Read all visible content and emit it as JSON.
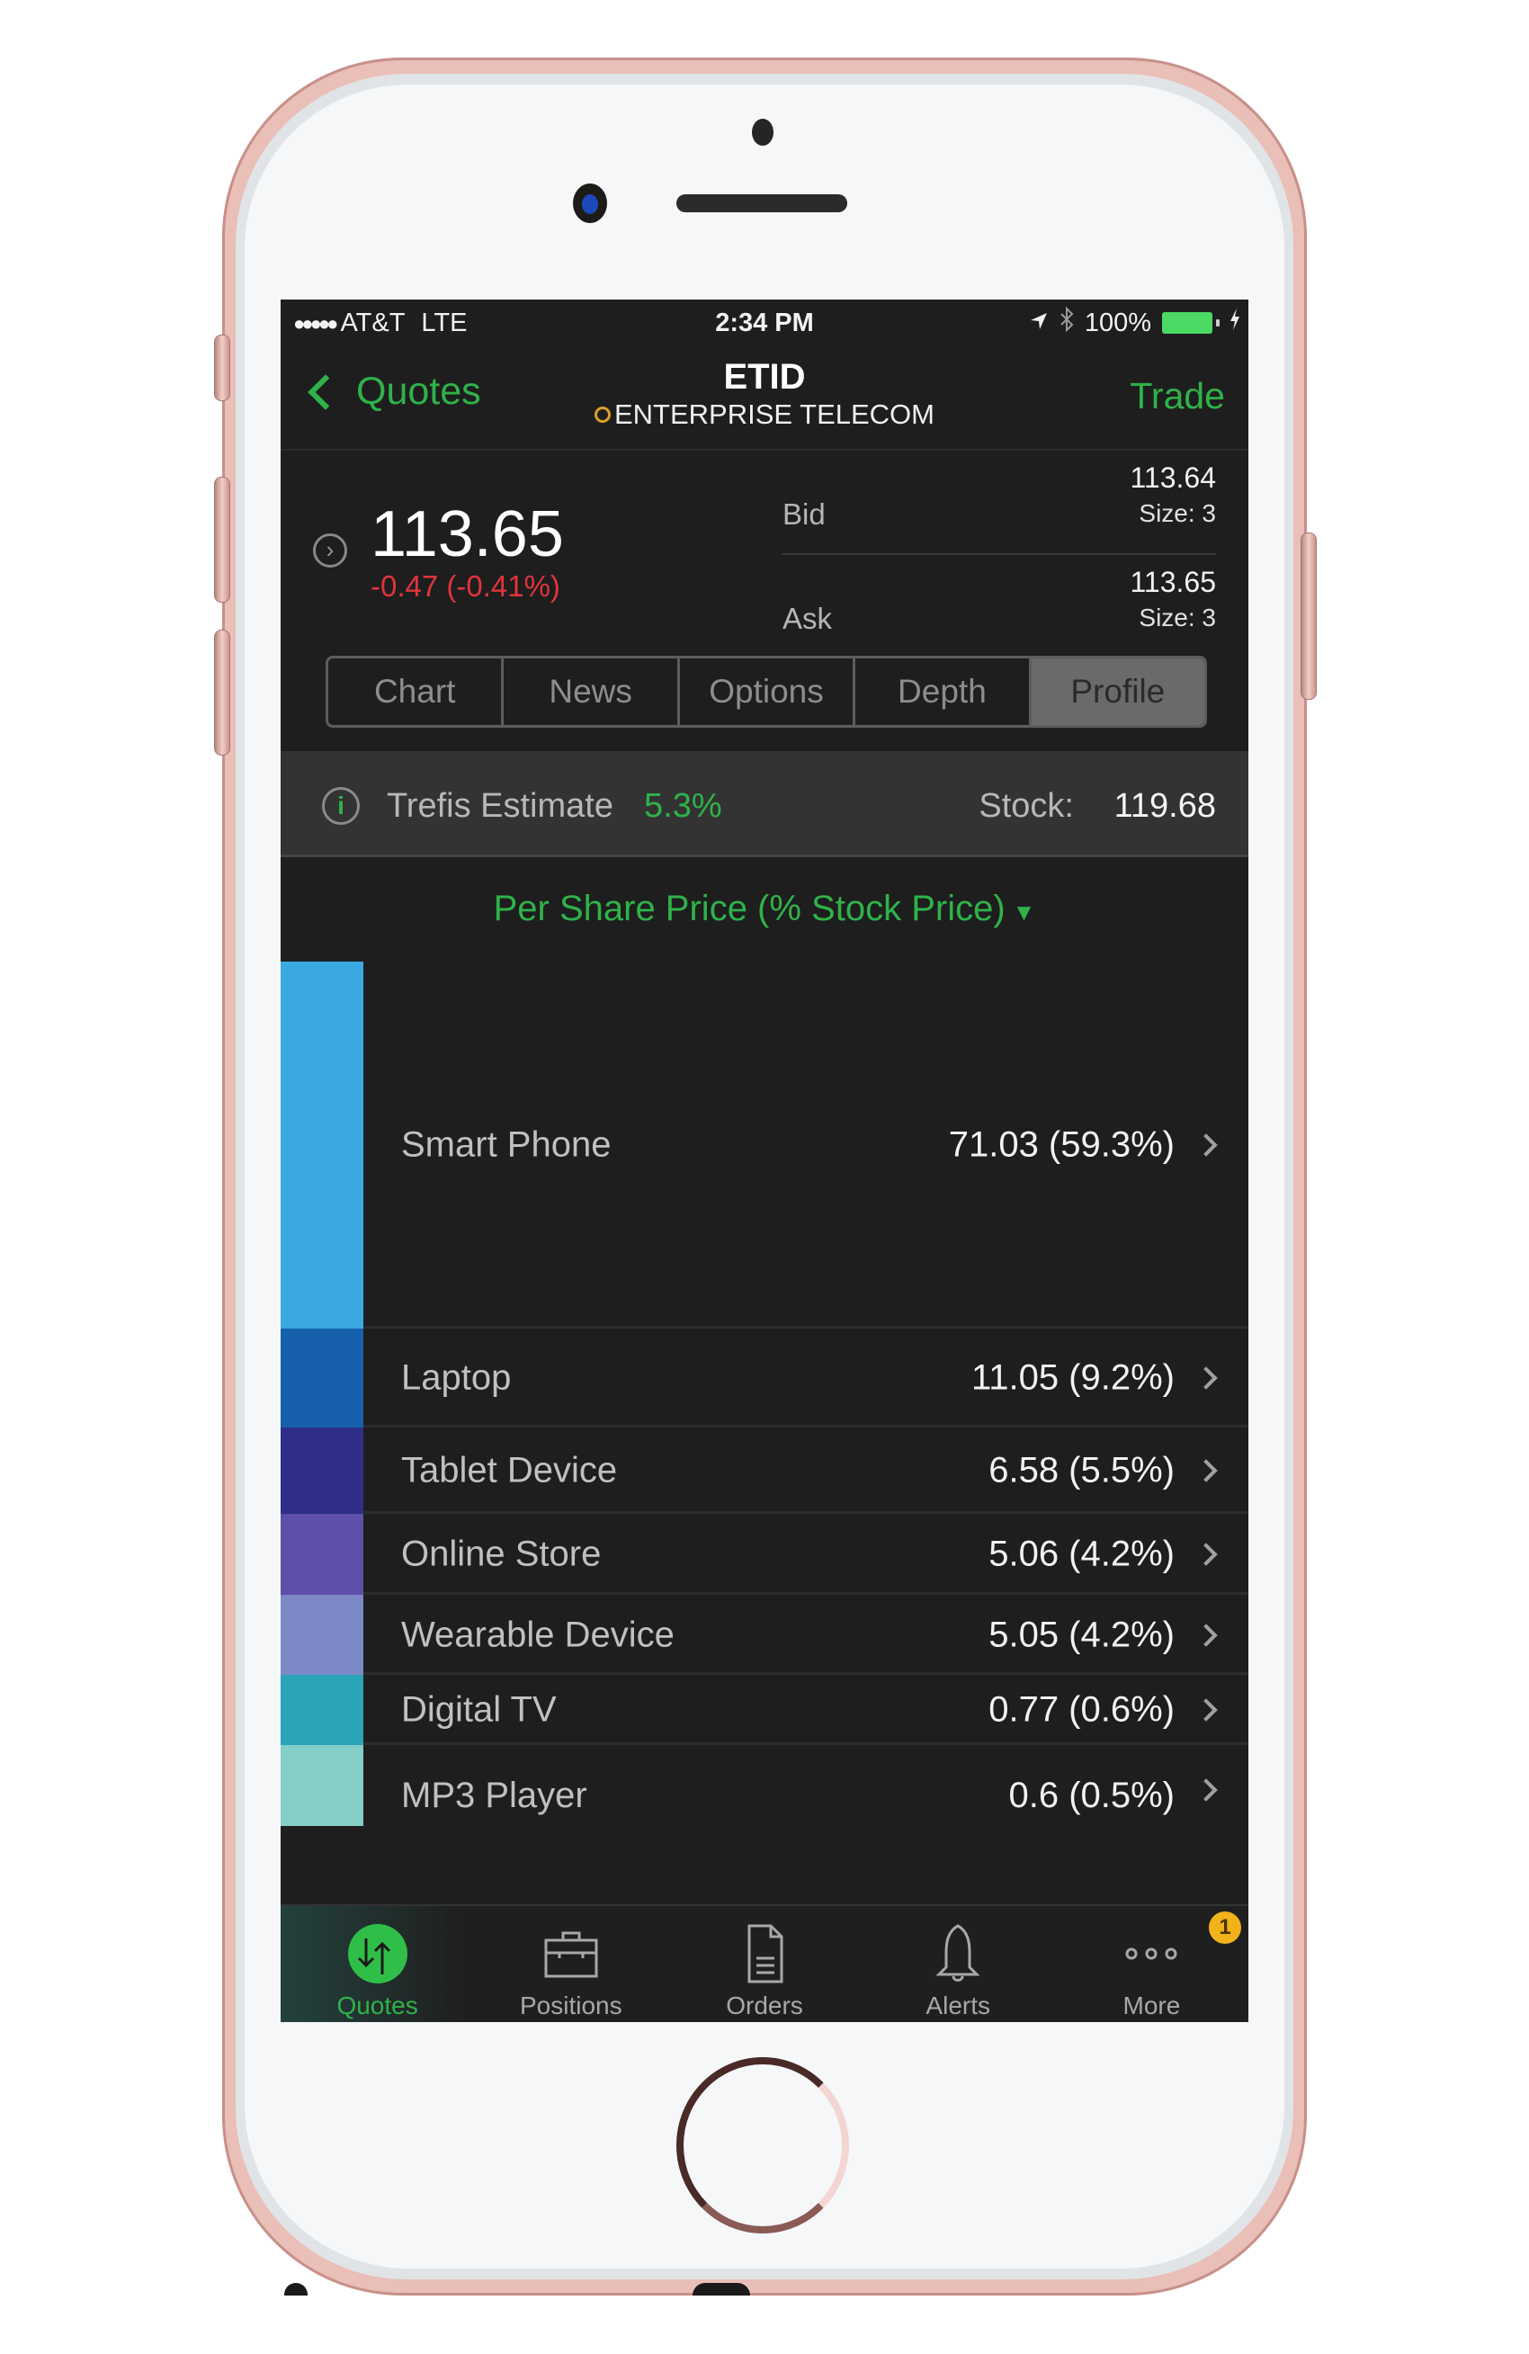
{
  "status_bar": {
    "signal": "●●●●●",
    "carrier": "AT&T",
    "network": "LTE",
    "time": "2:34 PM",
    "battery": "100%",
    "icons": [
      "location-arrow-icon",
      "bluetooth-icon",
      "battery-icon",
      "charging-bolt-icon"
    ]
  },
  "nav": {
    "back_label": "Quotes",
    "symbol": "ETID",
    "company": "ENTERPRISE TELECOM",
    "trade_label": "Trade"
  },
  "quote": {
    "last_price": "113.65",
    "change": "-0.47 (-0.41%)",
    "bid_label": "Bid",
    "bid_price": "113.64",
    "bid_size": "Size: 3",
    "ask_label": "Ask",
    "ask_price": "113.65",
    "ask_size": "Size: 3"
  },
  "tabs": [
    {
      "label": "Chart",
      "active": false
    },
    {
      "label": "News",
      "active": false
    },
    {
      "label": "Options",
      "active": false
    },
    {
      "label": "Depth",
      "active": false
    },
    {
      "label": "Profile",
      "active": true
    }
  ],
  "estimate": {
    "label": "Trefis Estimate",
    "value": "5.3%",
    "stock_label": "Stock:",
    "stock_value": "119.68"
  },
  "dropdown": {
    "label": "Per Share Price (% Stock Price)",
    "arrow": "▼"
  },
  "segments": [
    {
      "name": "Smart Phone",
      "value": "71.03 (59.3%)",
      "color": "#3aa9e1"
    },
    {
      "name": "Laptop",
      "value": "11.05 (9.2%)",
      "color": "#1760ab"
    },
    {
      "name": "Tablet Device",
      "value": "6.58 (5.5%)",
      "color": "#2f2e88"
    },
    {
      "name": "Online Store",
      "value": "5.06 (4.2%)",
      "color": "#5e4fa8"
    },
    {
      "name": "Wearable Device",
      "value": "5.05 (4.2%)",
      "color": "#7d88c7"
    },
    {
      "name": "Digital TV",
      "value": "0.77 (0.6%)",
      "color": "#2aa4b6"
    },
    {
      "name": "MP3 Player",
      "value": "0.6 (0.5%)",
      "color": "#86cec8"
    }
  ],
  "tab_bar": [
    {
      "label": "Quotes",
      "icon": "quotes-arrows-icon",
      "active": true
    },
    {
      "label": "Positions",
      "icon": "briefcase-icon",
      "active": false
    },
    {
      "label": "Orders",
      "icon": "document-icon",
      "active": false
    },
    {
      "label": "Alerts",
      "icon": "bell-icon",
      "active": false
    },
    {
      "label": "More",
      "icon": "more-dots-icon",
      "active": false,
      "badge": "1"
    }
  ],
  "colors": {
    "accent_green": "#2fb24a",
    "negative_red": "#e0343d",
    "badge_yellow": "#f2b21a"
  }
}
